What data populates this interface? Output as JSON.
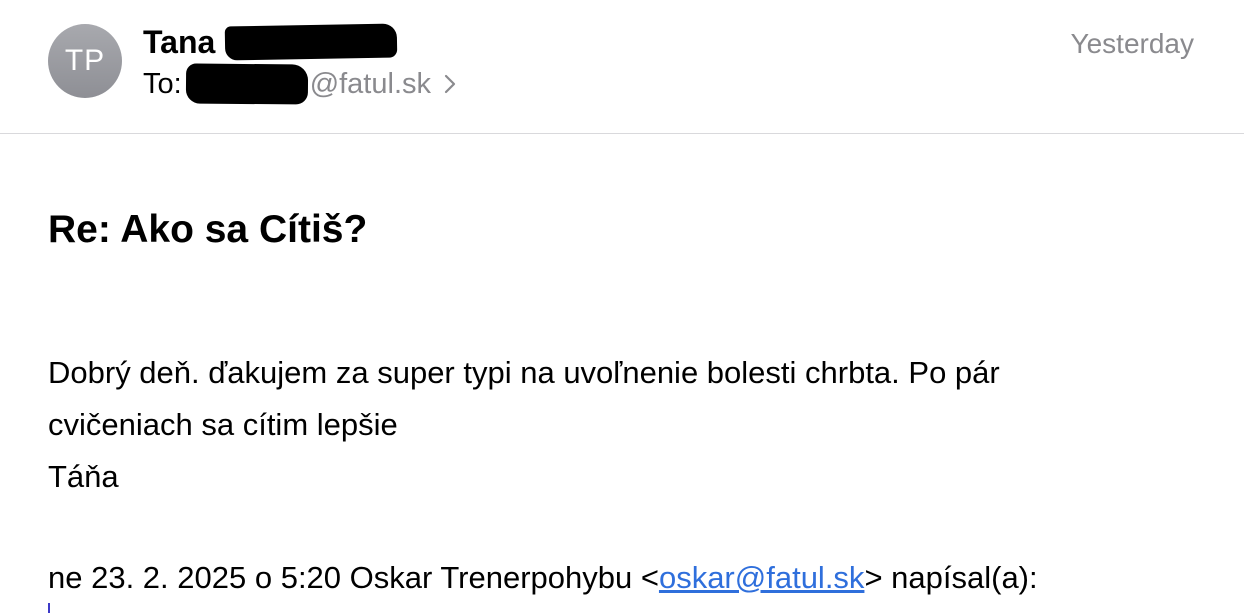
{
  "header": {
    "avatar_initials": "TP",
    "sender_name": "Tana",
    "to_label": "To:",
    "to_domain": "@fatul.sk",
    "date": "Yesterday",
    "chevron_icon": "chevron-right-icon"
  },
  "message": {
    "subject": "Re: Ako sa Cítiš?",
    "body_line_1": "Dobrý deň. ďakujem za super typi na uvoľnenie bolesti chrbta. Po pár",
    "body_line_2": "cvičeniach sa cítim lepšie",
    "signature": "Táňa",
    "quote_prefix": "ne 23. 2. 2025 o 5:20 Oskar Trenerpohybu <",
    "quote_email": "oskar@fatul.sk",
    "quote_suffix": "> napísal(a):"
  },
  "colors": {
    "secondary_text": "#8a8a8e",
    "link": "#2f6fdc",
    "avatar_bg": "#9b9ca1",
    "quote_bar": "#3d3ac8"
  }
}
